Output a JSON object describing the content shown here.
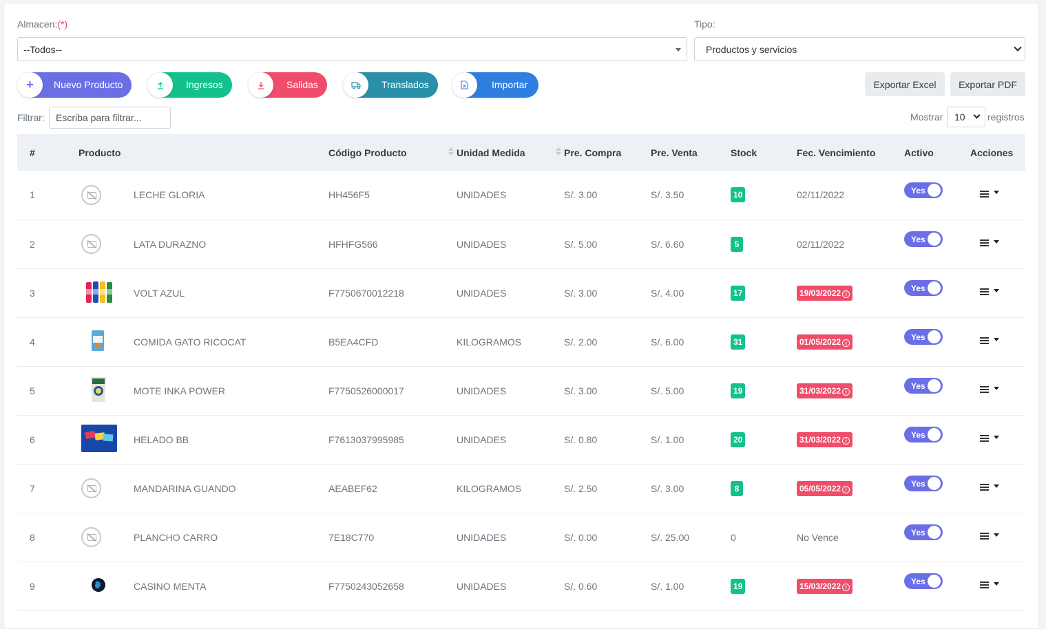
{
  "filters": {
    "almacen_label": "Almacen:",
    "almacen_required": "(*)",
    "almacen_value": "--Todos--",
    "tipo_label": "Tipo:",
    "tipo_value": "Productos y servicios"
  },
  "actions": {
    "nuevo": "Nuevo Producto",
    "ingresos": "Ingresos",
    "salidas": "Salidas",
    "translados": "Translados",
    "importar": "Importar",
    "exportar_excel": "Exportar Excel",
    "exportar_pdf": "Exportar PDF"
  },
  "icons": {
    "nuevo": "plus-icon",
    "ingresos": "upload-icon",
    "salidas": "download-icon",
    "translados": "truck-icon",
    "importar": "file-excel-icon"
  },
  "colors": {
    "nuevo": "#6b6fe6",
    "ingresos": "#14c18c",
    "salidas": "#ef4d6a",
    "translados": "#2a8fa8",
    "importar": "#2f7fe0",
    "stock_badge": "#14c18c",
    "expired_badge": "#ef4d6a",
    "toggle": "#6b6fe6"
  },
  "table_controls": {
    "filter_label": "Filtrar:",
    "filter_placeholder": "Escriba para filtrar...",
    "show_label": "Mostrar",
    "show_value": "10",
    "records_label": "registros"
  },
  "table": {
    "headers": {
      "num": "#",
      "producto": "Producto",
      "codigo": "Código Producto",
      "unidad": "Unidad Medida",
      "compra": "Pre. Compra",
      "venta": "Pre. Venta",
      "stock": "Stock",
      "vencimiento": "Fec. Vencimiento",
      "activo": "Activo",
      "acciones": "Acciones"
    },
    "toggle_label": "Yes",
    "rows": [
      {
        "num": "1",
        "image": "no-image-icon",
        "name": "LECHE GLORIA",
        "code": "HH456F5",
        "unit": "UNIDADES",
        "buy": "S/. 3.00",
        "sell": "S/. 3.50",
        "stock": "10",
        "stock_badge": true,
        "expiry": "02/11/2022",
        "expired": false
      },
      {
        "num": "2",
        "image": "no-image-icon",
        "name": "LATA DURAZNO",
        "code": "HFHFG566",
        "unit": "UNIDADES",
        "buy": "S/. 5.00",
        "sell": "S/. 6.60",
        "stock": "5",
        "stock_badge": true,
        "expiry": "02/11/2022",
        "expired": false
      },
      {
        "num": "3",
        "image": "bottles-photo",
        "name": "VOLT AZUL",
        "code": "F7750670012218",
        "unit": "UNIDADES",
        "buy": "S/. 3.00",
        "sell": "S/. 4.00",
        "stock": "17",
        "stock_badge": true,
        "expiry": "19/03/2022",
        "expired": true
      },
      {
        "num": "4",
        "image": "catfood-photo",
        "name": "COMIDA GATO RICOCAT",
        "code": "B5EA4CFD",
        "unit": "KILOGRAMOS",
        "buy": "S/. 2.00",
        "sell": "S/. 6.00",
        "stock": "31",
        "stock_badge": true,
        "expiry": "01/05/2022",
        "expired": true
      },
      {
        "num": "5",
        "image": "bag-photo",
        "name": "MOTE INKA POWER",
        "code": "F7750526000017",
        "unit": "UNIDADES",
        "buy": "S/. 3.00",
        "sell": "S/. 5.00",
        "stock": "19",
        "stock_badge": true,
        "expiry": "31/03/2022",
        "expired": true
      },
      {
        "num": "6",
        "image": "icecream-photo",
        "name": "HELADO BB",
        "code": "F7613037995985",
        "unit": "UNIDADES",
        "buy": "S/. 0.80",
        "sell": "S/. 1.00",
        "stock": "20",
        "stock_badge": true,
        "expiry": "31/03/2022",
        "expired": true
      },
      {
        "num": "7",
        "image": "no-image-icon",
        "name": "MANDARINA GUANDO",
        "code": "AEABEF62",
        "unit": "KILOGRAMOS",
        "buy": "S/. 2.50",
        "sell": "S/. 3.00",
        "stock": "8",
        "stock_badge": true,
        "expiry": "05/05/2022",
        "expired": true
      },
      {
        "num": "8",
        "image": "no-image-icon",
        "name": "PLANCHO CARRO",
        "code": "7E18C770",
        "unit": "UNIDADES",
        "buy": "S/. 0.00",
        "sell": "S/. 25.00",
        "stock": "0",
        "stock_badge": false,
        "expiry": "No Vence",
        "expired": false
      },
      {
        "num": "9",
        "image": "candy-photo",
        "name": "CASINO MENTA",
        "code": "F7750243052658",
        "unit": "UNIDADES",
        "buy": "S/. 0.60",
        "sell": "S/. 1.00",
        "stock": "19",
        "stock_badge": true,
        "expiry": "15/03/2022",
        "expired": true
      }
    ]
  }
}
